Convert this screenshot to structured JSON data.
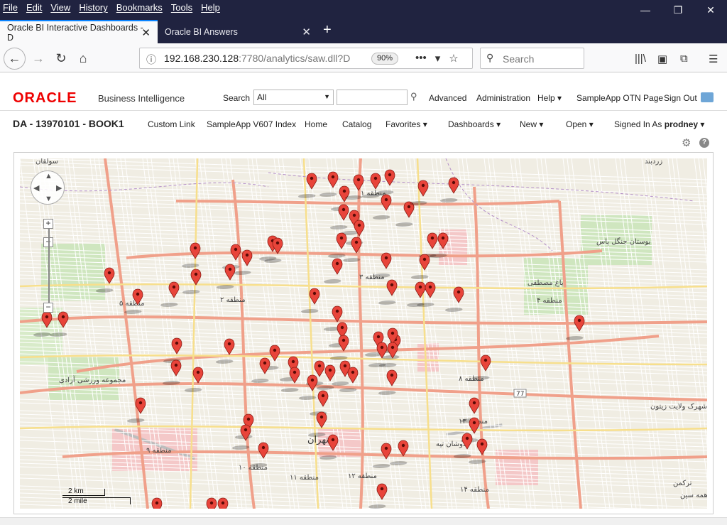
{
  "browser": {
    "menu": [
      "File",
      "Edit",
      "View",
      "History",
      "Bookmarks",
      "Tools",
      "Help"
    ],
    "tabs": [
      {
        "label": "Oracle BI Interactive Dashboards - D"
      },
      {
        "label": "Oracle BI Answers"
      }
    ],
    "url_host": "192.168.230.128",
    "url_rest": ":7780/analytics/saw.dll?D",
    "zoom": "90%",
    "search_placeholder": "Search",
    "window_controls": {
      "minimize": "—",
      "restore": "❐",
      "close": "✕"
    }
  },
  "obi": {
    "logo": "ORACLE",
    "product": "Business Intelligence",
    "search_label": "Search",
    "search_scope": "All",
    "links": [
      "Advanced",
      "Administration",
      "Help",
      "SampleApp OTN Page",
      "Sign Out"
    ],
    "dashboard_title": "DA - 13970101 - BOOK1",
    "nav": [
      "Custom Link",
      "SampleApp V607 Index",
      "Home",
      "Catalog",
      "Favorites",
      "Dashboards",
      "New",
      "Open"
    ],
    "signed_in_label": "Signed In As",
    "user": "prodney"
  },
  "map": {
    "scale_km": "2 km",
    "scale_mile": "2 mile",
    "city_label": "تهران",
    "labels": [
      {
        "text": "منطقه ۱"
      },
      {
        "text": "منطقه ۲"
      },
      {
        "text": "منطقه ۳"
      },
      {
        "text": "منطقه ۴"
      },
      {
        "text": "منطقه ۵"
      },
      {
        "text": "منطقه ۸"
      },
      {
        "text": "منطقه ۹"
      },
      {
        "text": "منطقه ۱۰"
      },
      {
        "text": "منطقه ۱۱"
      },
      {
        "text": "منطقه ۱۲"
      },
      {
        "text": "منطقه ۱۳"
      },
      {
        "text": "منطقه ۱۴"
      },
      {
        "text": "باغ مصطفی"
      },
      {
        "text": "بوستان جنگل پاس"
      },
      {
        "text": "شهرک ولایت زیتون"
      },
      {
        "text": "دوشان تپه"
      },
      {
        "text": "مجموعه ورزشی آزادی"
      },
      {
        "text": "سولقان"
      },
      {
        "text": "زردبند"
      },
      {
        "text": "ترکمن"
      },
      {
        "text": "همه سین"
      }
    ],
    "route_label": "77",
    "marker_color": "#e8443a"
  }
}
